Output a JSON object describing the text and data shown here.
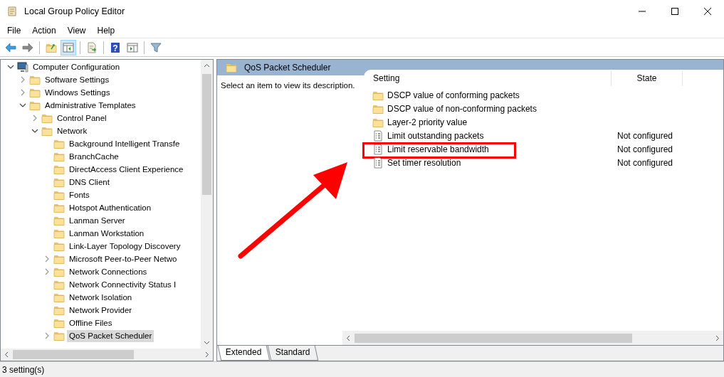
{
  "window": {
    "title": "Local Group Policy Editor"
  },
  "menu": [
    "File",
    "Action",
    "View",
    "Help"
  ],
  "toolbar": [
    {
      "kind": "back",
      "pressed": false
    },
    {
      "kind": "forward",
      "pressed": false
    },
    {
      "kind": "sep"
    },
    {
      "kind": "up",
      "pressed": false
    },
    {
      "kind": "tree",
      "pressed": true
    },
    {
      "kind": "sep"
    },
    {
      "kind": "export",
      "pressed": false
    },
    {
      "kind": "sep"
    },
    {
      "kind": "help",
      "label": "?",
      "pressed": false
    },
    {
      "kind": "action",
      "pressed": false
    },
    {
      "kind": "sep"
    },
    {
      "kind": "filter",
      "pressed": false
    }
  ],
  "tree": [
    {
      "label": "Computer Configuration",
      "kind": "computer",
      "expanded": true,
      "selected": false,
      "children": [
        {
          "label": "Software Settings",
          "kind": "folder",
          "expanded": false,
          "selected": false
        },
        {
          "label": "Windows Settings",
          "kind": "folder",
          "expanded": false,
          "selected": false
        },
        {
          "label": "Administrative Templates",
          "kind": "folder",
          "expanded": true,
          "selected": false,
          "children": [
            {
              "label": "Control Panel",
              "kind": "folder",
              "expanded": false,
              "selected": false
            },
            {
              "label": "Network",
              "kind": "folder",
              "expanded": true,
              "selected": false,
              "children": [
                {
                  "label": "Background Intelligent Transfe",
                  "kind": "folder",
                  "selected": false
                },
                {
                  "label": "BranchCache",
                  "kind": "folder",
                  "selected": false
                },
                {
                  "label": "DirectAccess Client Experience",
                  "kind": "folder",
                  "selected": false
                },
                {
                  "label": "DNS Client",
                  "kind": "folder",
                  "selected": false
                },
                {
                  "label": "Fonts",
                  "kind": "folder",
                  "selected": false
                },
                {
                  "label": "Hotspot Authentication",
                  "kind": "folder",
                  "selected": false
                },
                {
                  "label": "Lanman Server",
                  "kind": "folder",
                  "selected": false
                },
                {
                  "label": "Lanman Workstation",
                  "kind": "folder",
                  "selected": false
                },
                {
                  "label": "Link-Layer Topology Discovery",
                  "kind": "folder",
                  "selected": false
                },
                {
                  "label": "Microsoft Peer-to-Peer Netwo",
                  "kind": "folder",
                  "expanded": false,
                  "selected": false
                },
                {
                  "label": "Network Connections",
                  "kind": "folder",
                  "expanded": false,
                  "selected": false
                },
                {
                  "label": "Network Connectivity Status I",
                  "kind": "folder",
                  "selected": false
                },
                {
                  "label": "Network Isolation",
                  "kind": "folder",
                  "selected": false
                },
                {
                  "label": "Network Provider",
                  "kind": "folder",
                  "selected": false
                },
                {
                  "label": "Offline Files",
                  "kind": "folder",
                  "selected": false
                },
                {
                  "label": "QoS Packet Scheduler",
                  "kind": "folder",
                  "expanded": false,
                  "selected": true
                }
              ]
            }
          ]
        }
      ]
    }
  ],
  "details": {
    "header": "QoS Packet Scheduler",
    "description": "Select an item to view its description.",
    "columns": [
      "Setting",
      "State"
    ],
    "rows": [
      {
        "kind": "folder",
        "setting": "DSCP value of conforming packets",
        "highlighted": false
      },
      {
        "kind": "folder",
        "setting": "DSCP value of non-conforming packets",
        "highlighted": false
      },
      {
        "kind": "folder",
        "setting": "Layer-2 priority value",
        "highlighted": false
      },
      {
        "kind": "policy",
        "setting": "Limit outstanding packets",
        "state": "Not configured",
        "highlighted": false
      },
      {
        "kind": "policy",
        "setting": "Limit reservable bandwidth",
        "state": "Not configured",
        "highlighted": true
      },
      {
        "kind": "policy",
        "setting": "Set timer resolution",
        "state": "Not configured",
        "highlighted": false
      }
    ]
  },
  "tabs": [
    {
      "label": "Extended",
      "selected": true
    },
    {
      "label": "Standard",
      "selected": false
    }
  ],
  "status_bar": "3 setting(s)"
}
